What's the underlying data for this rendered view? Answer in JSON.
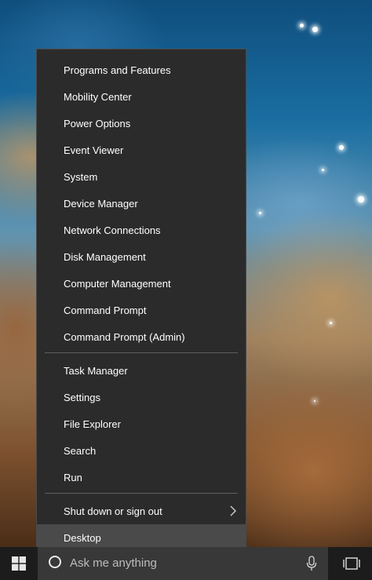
{
  "menu": {
    "group1": [
      {
        "label": "Programs and Features"
      },
      {
        "label": "Mobility Center"
      },
      {
        "label": "Power Options"
      },
      {
        "label": "Event Viewer"
      },
      {
        "label": "System"
      },
      {
        "label": "Device Manager"
      },
      {
        "label": "Network Connections"
      },
      {
        "label": "Disk Management"
      },
      {
        "label": "Computer Management"
      },
      {
        "label": "Command Prompt"
      },
      {
        "label": "Command Prompt (Admin)"
      }
    ],
    "group2": [
      {
        "label": "Task Manager"
      },
      {
        "label": "Settings"
      },
      {
        "label": "File Explorer"
      },
      {
        "label": "Search"
      },
      {
        "label": "Run"
      }
    ],
    "group3": [
      {
        "label": "Shut down or sign out",
        "submenu_icon": "chevron-right-icon"
      },
      {
        "label": "Desktop",
        "highlighted": true
      }
    ]
  },
  "taskbar": {
    "start_icon": "windows-logo-icon",
    "search_placeholder": "Ask me anything",
    "cortana_icon": "cortana-circle-icon",
    "mic_icon": "microphone-icon",
    "task_view_icon": "task-view-icon"
  },
  "colors": {
    "menu_bg": "#2b2b2b",
    "menu_hover": "#4a4a4a",
    "menu_text": "#ffffff",
    "separator": "#5e5e5e",
    "taskbar_bg": "#1c1c1c",
    "searchbox_bg": "#383838",
    "search_text": "#bdbdbd"
  }
}
